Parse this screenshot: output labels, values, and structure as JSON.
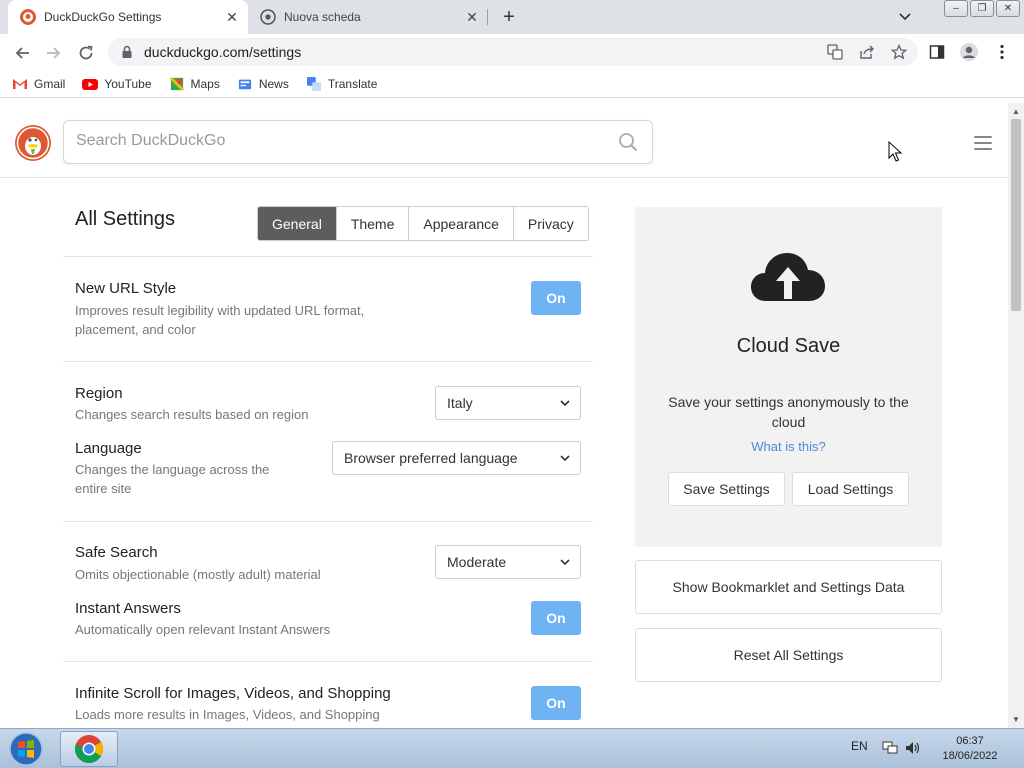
{
  "browser": {
    "tabs": [
      {
        "title": "DuckDuckGo Settings",
        "active": true
      },
      {
        "title": "Nuova scheda",
        "active": false
      }
    ],
    "url": "duckduckgo.com/settings",
    "bookmarks": [
      "Gmail",
      "YouTube",
      "Maps",
      "News",
      "Translate"
    ]
  },
  "header": {
    "search_placeholder": "Search DuckDuckGo"
  },
  "settings": {
    "title": "All Settings",
    "tabs": [
      "General",
      "Theme",
      "Appearance",
      "Privacy"
    ],
    "selected_tab": "General",
    "items": {
      "url_style": {
        "title": "New URL Style",
        "desc": "Improves result legibility with updated URL format, placement, and color",
        "value": "On"
      },
      "region": {
        "title": "Region",
        "desc": "Changes search results based on region",
        "value": "Italy"
      },
      "language": {
        "title": "Language",
        "desc": "Changes the language across the entire site",
        "value": "Browser preferred language"
      },
      "safe_search": {
        "title": "Safe Search",
        "desc": "Omits objectionable (mostly adult) material",
        "value": "Moderate"
      },
      "instant_answers": {
        "title": "Instant Answers",
        "desc": "Automatically open relevant Instant Answers",
        "value": "On"
      },
      "infinite_scroll": {
        "title": "Infinite Scroll for Images, Videos, and Shopping",
        "desc": "Loads more results in Images, Videos, and Shopping",
        "value": "On"
      }
    }
  },
  "cloud_save": {
    "title": "Cloud Save",
    "desc": "Save your settings anonymously to the cloud",
    "link": "What is this?",
    "save_label": "Save Settings",
    "load_label": "Load Settings"
  },
  "actions": {
    "bookmarklet_label": "Show Bookmarklet and Settings Data",
    "reset_label": "Reset All Settings"
  },
  "taskbar": {
    "lang": "EN",
    "time": "06:37",
    "date": "18/06/2022"
  },
  "colors": {
    "toggle_on": "#6fb3f4",
    "tab_selected": "#5d5d5d",
    "link": "#4e8ad6",
    "ddg_orange": "#de5833"
  }
}
